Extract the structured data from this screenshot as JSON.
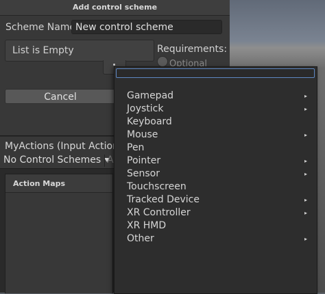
{
  "dialog": {
    "title": "Add control scheme",
    "scheme_name_label": "Scheme Name",
    "scheme_name_value": "New control scheme",
    "list_empty": "List is Empty",
    "requirements_label": "Requirements:",
    "optional_label": "Optional",
    "cancel_label": "Cancel"
  },
  "asset": {
    "title": "MyActions (Input Actions)",
    "scheme_dropdown": "No Control Schemes",
    "devices_partial": "A",
    "action_maps_title": "Action Maps"
  },
  "popup": {
    "items": [
      {
        "label": "Gamepad",
        "submenu": "▸"
      },
      {
        "label": "Joystick",
        "submenu": "▸"
      },
      {
        "label": "Keyboard",
        "submenu": ""
      },
      {
        "label": "Mouse",
        "submenu": "▸"
      },
      {
        "label": "Pen",
        "submenu": ""
      },
      {
        "label": "Pointer",
        "submenu": "▸"
      },
      {
        "label": "Sensor",
        "submenu": "▸"
      },
      {
        "label": "Touchscreen",
        "submenu": ""
      },
      {
        "label": "Tracked Device",
        "submenu": "▸"
      },
      {
        "label": "XR Controller",
        "submenu": "▸"
      },
      {
        "label": "XR HMD",
        "submenu": ""
      },
      {
        "label": "Other",
        "submenu": "▸"
      }
    ]
  },
  "colors": {
    "panel": "#383838",
    "popup": "#2d2d2d",
    "focus": "#5f88c4"
  }
}
